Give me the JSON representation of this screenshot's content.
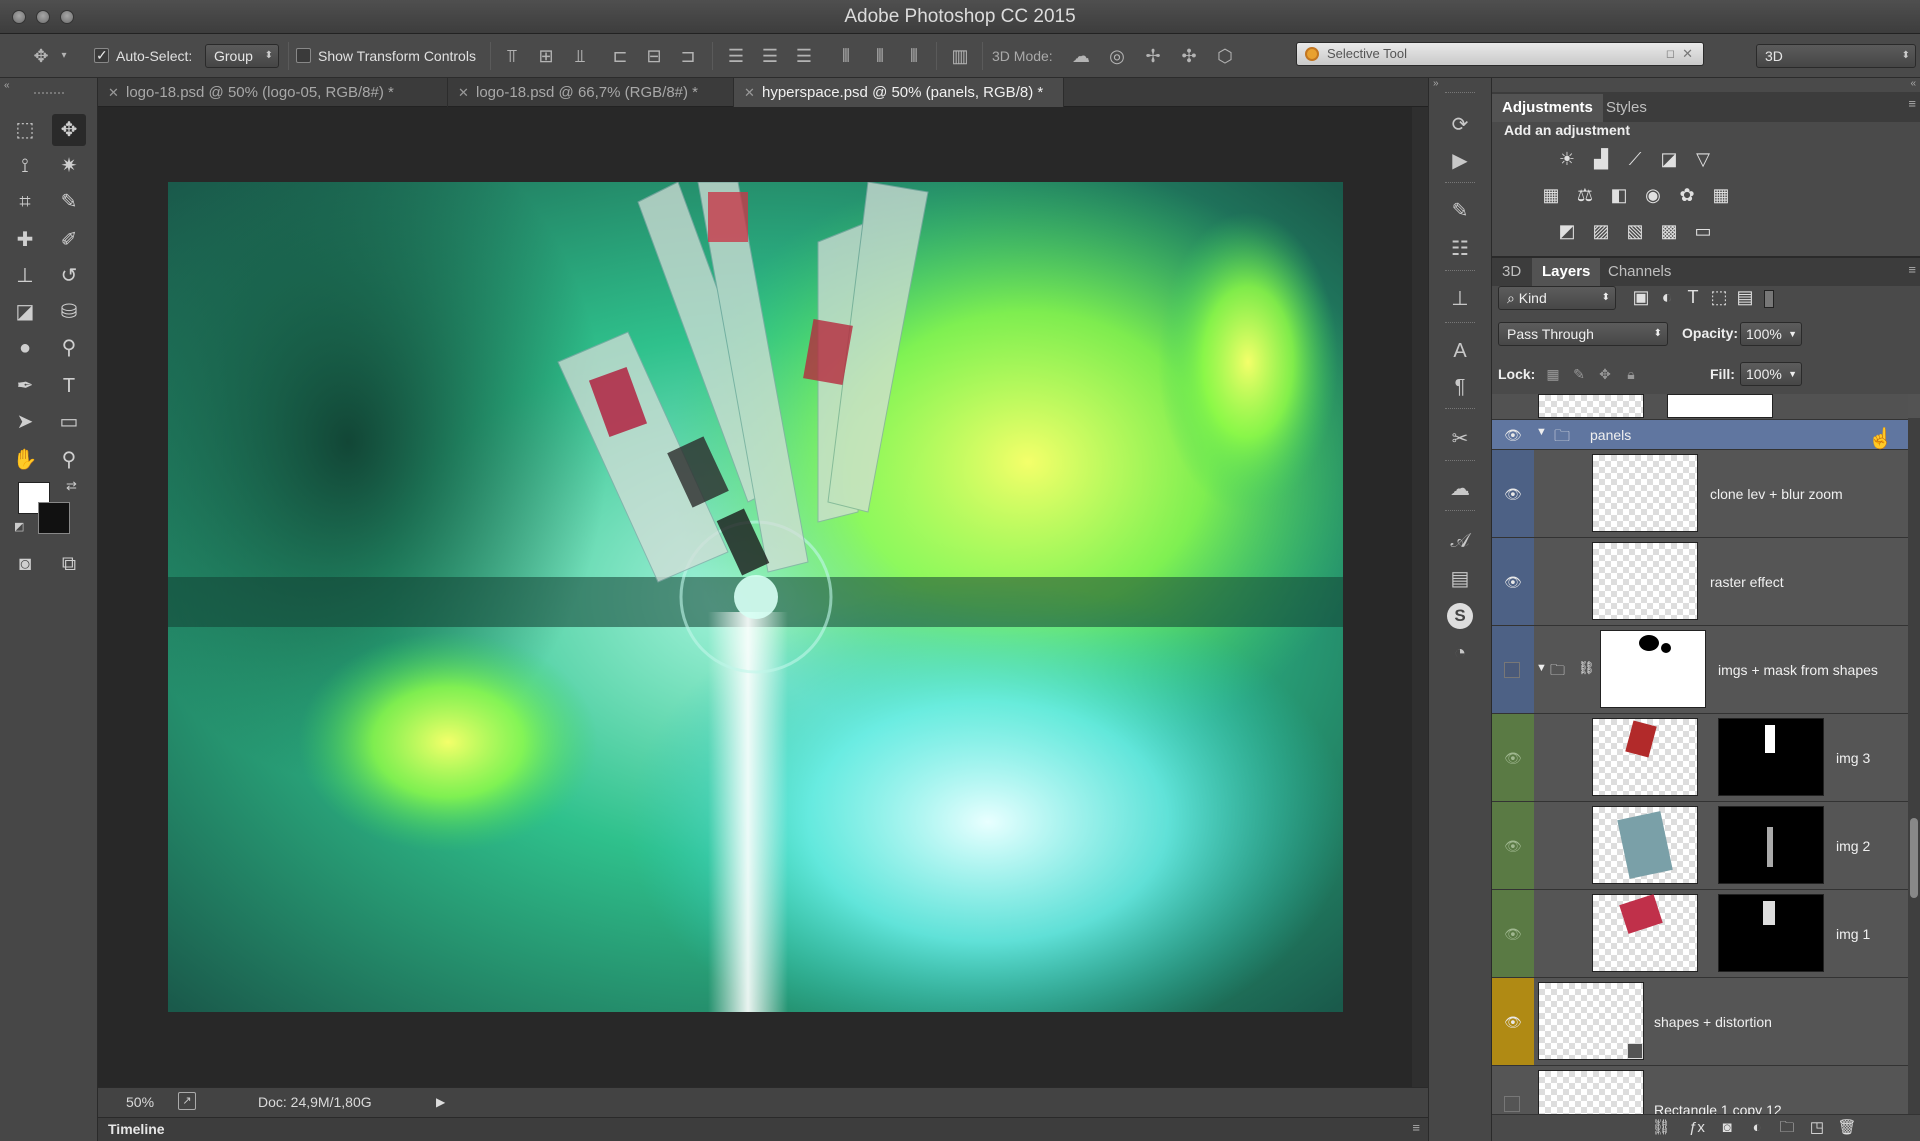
{
  "window": {
    "title": "Adobe Photoshop CC 2015"
  },
  "options": {
    "auto_select_label": "Auto-Select:",
    "auto_select_value": "Group",
    "show_transform_label": "Show Transform Controls",
    "mode_3d_label": "3D Mode:",
    "selective_tool": "Selective Tool",
    "workspace": "3D"
  },
  "tabs": [
    {
      "label": "logo-18.psd @ 50% (logo-05, RGB/8#) *"
    },
    {
      "label": "logo-18.psd @ 66,7% (RGB/8#) *"
    },
    {
      "label": "hyperspace.psd @ 50% (panels, RGB/8) *"
    }
  ],
  "status": {
    "zoom": "50%",
    "doc": "Doc: 24,9M/1,80G"
  },
  "timeline": {
    "label": "Timeline"
  },
  "panels": {
    "adj_tabs": [
      "Adjustments",
      "Styles"
    ],
    "add_adjustment": "Add an adjustment",
    "layer_tabs": [
      "3D",
      "Layers",
      "Channels"
    ],
    "filter_kind": "Kind",
    "blend_mode": "Pass Through",
    "opacity_label": "Opacity:",
    "opacity_value": "100%",
    "lock_label": "Lock:",
    "fill_label": "Fill:",
    "fill_value": "100%"
  },
  "layers": [
    {
      "name": "panels",
      "visible": true,
      "color": "#5b6a8a"
    },
    {
      "name": "clone lev + blur zoom",
      "visible": true,
      "color": "#4d6185"
    },
    {
      "name": "raster effect",
      "visible": true,
      "color": "#4d6185"
    },
    {
      "name": "imgs + mask from shapes",
      "visible": false,
      "color": "#4d6185"
    },
    {
      "name": "img 3",
      "visible": true,
      "color": "#5a7a44"
    },
    {
      "name": "img 2",
      "visible": true,
      "color": "#5a7a44"
    },
    {
      "name": "img 1",
      "visible": true,
      "color": "#5a7a44"
    },
    {
      "name": "shapes + distortion",
      "visible": true,
      "color": "#b08a14"
    },
    {
      "name": "Rectangle 1 copy 12",
      "visible": false,
      "color": "#555555"
    }
  ]
}
